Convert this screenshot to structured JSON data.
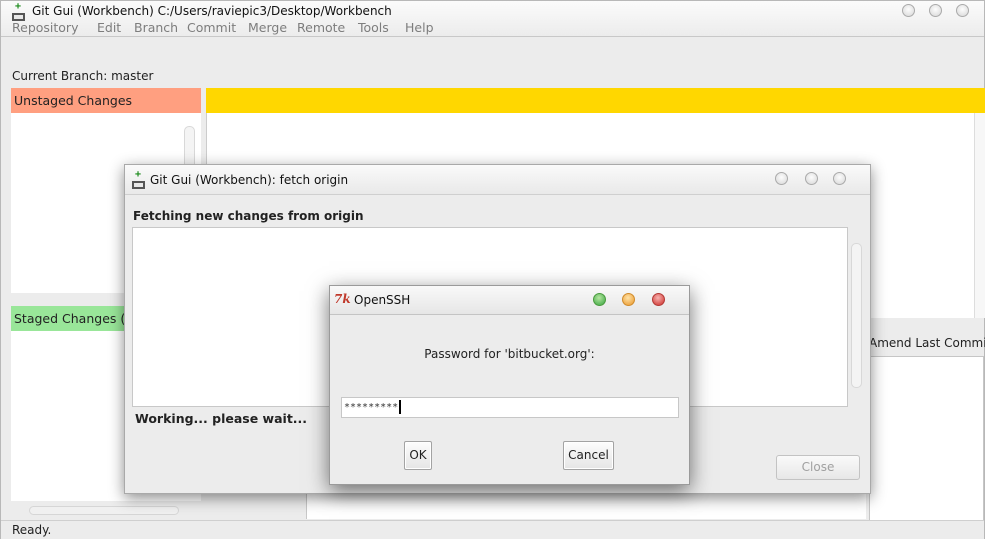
{
  "main_window": {
    "title": "Git Gui (Workbench) C:/Users/raviepic3/Desktop/Workbench",
    "menu": [
      "Repository",
      "Edit",
      "Branch",
      "Commit",
      "Merge",
      "Remote",
      "Tools",
      "Help"
    ],
    "current_branch": "Current Branch: master",
    "unstaged_label": "Unstaged Changes",
    "staged_label": "Staged Changes (Will Commit)",
    "amend_label": "Amend Last Commit",
    "status": "Ready."
  },
  "fetch_dialog": {
    "title": "Git Gui (Workbench): fetch origin",
    "heading": "Fetching new changes from origin",
    "working_text": "Working... please wait...",
    "close_label": "Close"
  },
  "ssh_dialog": {
    "title": "OpenSSH",
    "prompt": "Password for 'bitbucket.org':",
    "password_value": "*********",
    "ok_label": "OK",
    "cancel_label": "Cancel",
    "traffic_colors": {
      "green": "#5cb85c",
      "yellow": "#f0ad4e",
      "red": "#d9534f"
    }
  },
  "colors": {
    "unstaged": "#ff9f80",
    "staged": "#99e699",
    "diff_header": "#ffd700"
  },
  "icons": {
    "app": "git-gui-icon",
    "tk": "tk-feather-icon"
  }
}
